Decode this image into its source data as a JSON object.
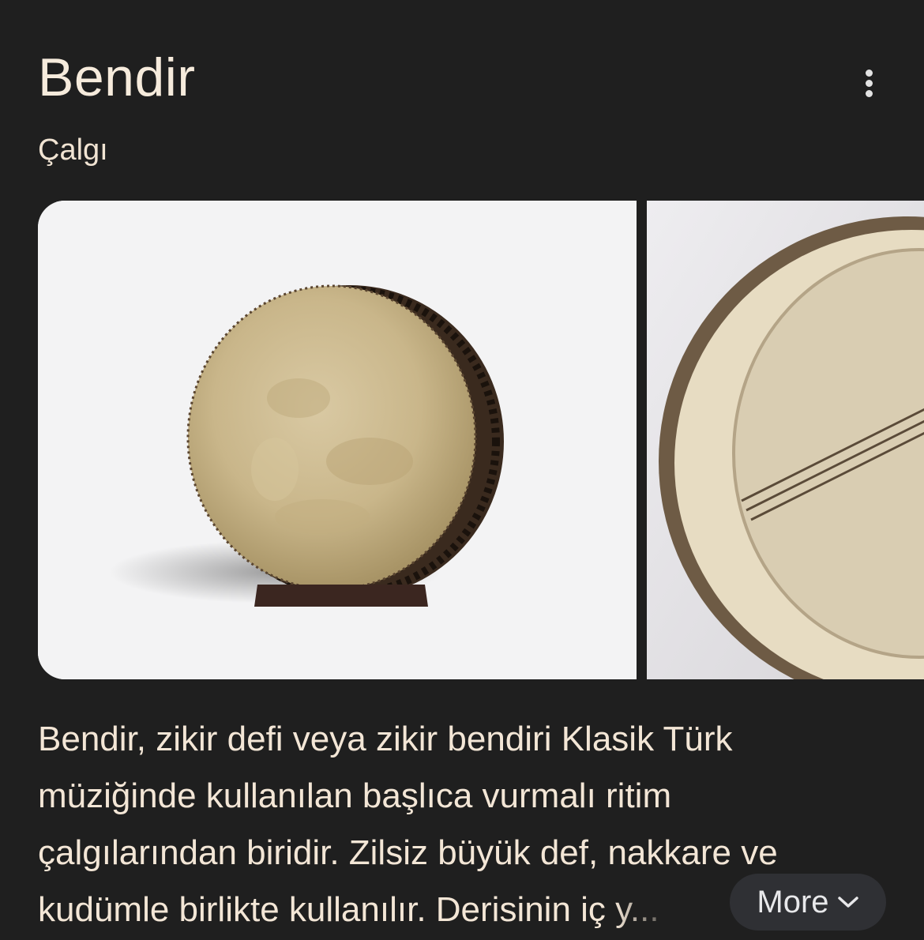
{
  "header": {
    "title": "Bendir",
    "subtitle": "Çalgı"
  },
  "menu": {
    "icon": "more-vert-icon"
  },
  "images": [
    {
      "alt": "Bendir drum on stand"
    },
    {
      "alt": "Bendir drum interior"
    }
  ],
  "description": {
    "line1": "Bendir, zikir defi veya zikir bendiri Klasik Türk",
    "line2": "müziğinde kullanılan başlıca vurmalı ritim",
    "line3": "çalgılarından biridir. Zilsiz büyük def, nakkare ve",
    "line4_main": "kudümle birlikte kullanılır. Derisinin iç ",
    "line4_fade": "y...",
    "ellipsis": ""
  },
  "more_button": {
    "label": "More",
    "icon": "chevron-down-icon"
  },
  "colors": {
    "background": "#1f1f1f",
    "text": "#f3e6d6",
    "button_bg": "#2f3034"
  }
}
